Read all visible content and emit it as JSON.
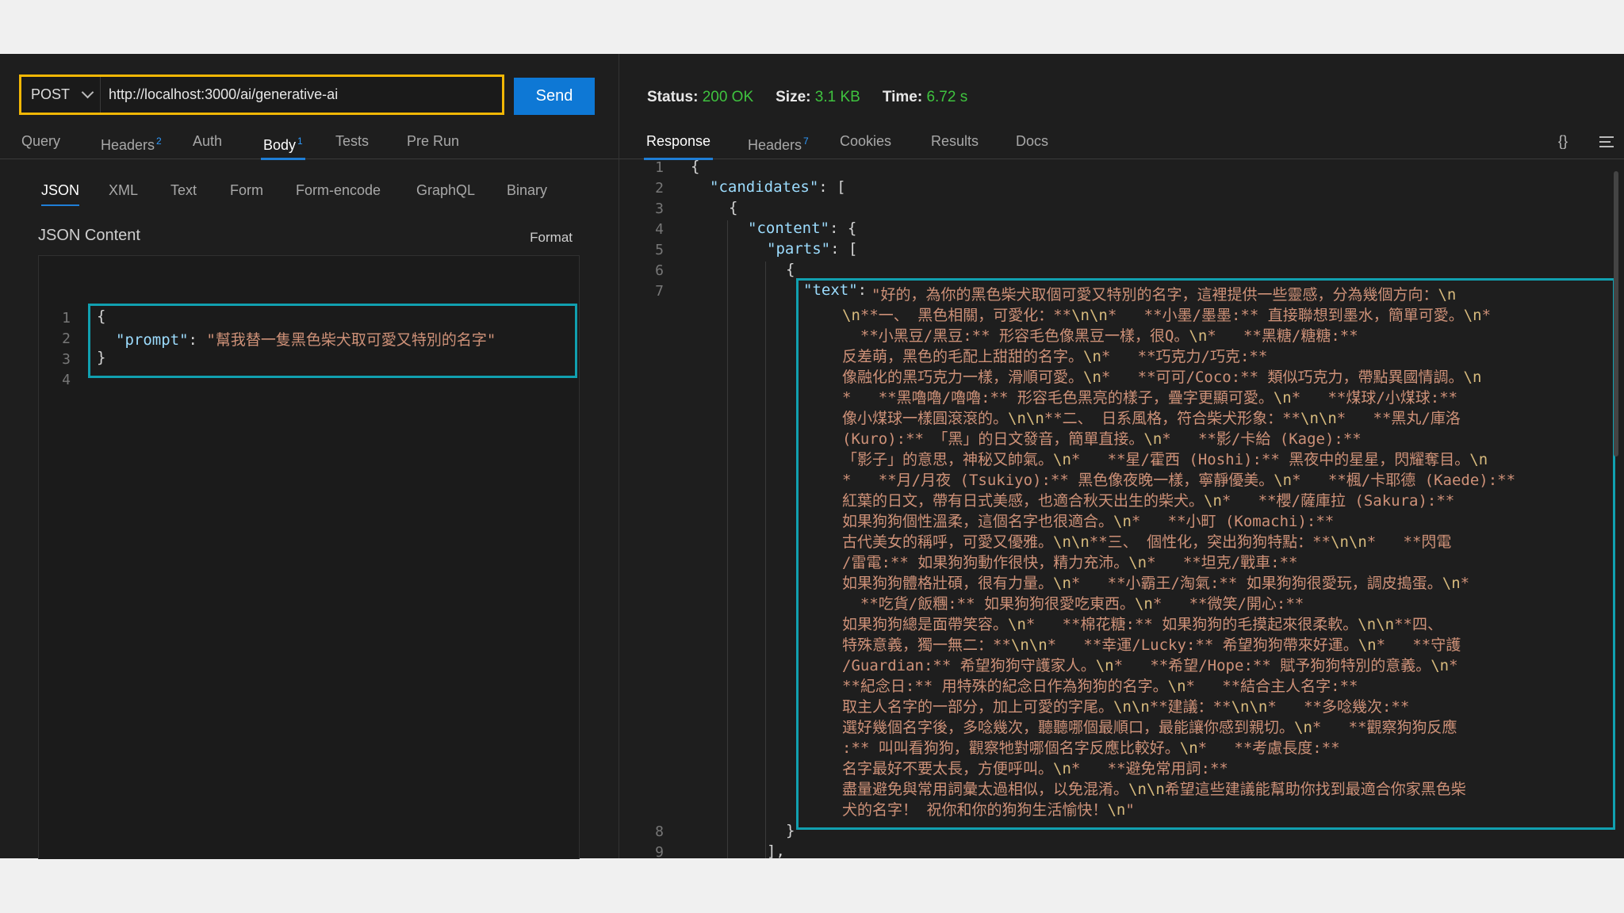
{
  "request": {
    "method": "POST",
    "url": "http://localhost:3000/ai/generative-ai",
    "send_label": "Send",
    "tabs": [
      {
        "label": "Query"
      },
      {
        "label": "Headers",
        "badge": "2"
      },
      {
        "label": "Auth"
      },
      {
        "label": "Body",
        "badge": "1",
        "active": true
      },
      {
        "label": "Tests"
      },
      {
        "label": "Pre Run"
      }
    ],
    "body_tabs": [
      "JSON",
      "XML",
      "Text",
      "Form",
      "Form-encode",
      "GraphQL",
      "Binary"
    ],
    "json_content_label": "JSON Content",
    "format_label": "Format",
    "editor": {
      "line_numbers": [
        "1",
        "2",
        "3",
        "4"
      ],
      "open_brace": "{",
      "key": "\"prompt\"",
      "colon": ": ",
      "value": "\"幫我替一隻黑色柴犬取可愛又特別的名字\"",
      "close_brace": "}"
    }
  },
  "response": {
    "status_label": "Status:",
    "status_value": "200 OK",
    "size_label": "Size:",
    "size_value": "3.1 KB",
    "time_label": "Time:",
    "time_value": "6.72 s",
    "tabs": [
      {
        "label": "Response",
        "active": true
      },
      {
        "label": "Headers",
        "badge": "7"
      },
      {
        "label": "Cookies"
      },
      {
        "label": "Results"
      },
      {
        "label": "Docs"
      }
    ],
    "icons": [
      "braces-icon",
      "menu-icon"
    ],
    "braces_glyph": "{}",
    "line_numbers": [
      "1",
      "2",
      "3",
      "4",
      "5",
      "6",
      "7",
      "8",
      "9"
    ],
    "code": {
      "l1": "{",
      "l2_key": "\"candidates\"",
      "l2_rest": ": [",
      "l3": "{",
      "l4_key": "\"content\"",
      "l4_rest": ": {",
      "l5_key": "\"parts\"",
      "l5_rest": ": [",
      "l6": "{",
      "l7_key": "\"text\"",
      "l7_colon": ": ",
      "l8": "}",
      "l9": "],"
    },
    "text_lines": [
      "\"好的，為你的黑色柴犬取個可愛又特別的名字，這裡提供一些靈感，分為幾個方向：\\n",
      "\\n**一、 黑色相關，可愛化：**\\n\\n*   **小墨/墨墨:** 直接聯想到墨水，簡單可愛。\\n*",
      "  **小黑豆/黑豆:** 形容毛色像黑豆一樣，很Q。\\n*   **黑糖/糖糖:**",
      "反差萌，黑色的毛配上甜甜的名字。\\n*   **巧克力/巧克:**",
      "像融化的黑巧克力一樣，滑順可愛。\\n*   **可可/Coco:** 類似巧克力，帶點異國情調。\\n",
      "*   **黑嚕嚕/嚕嚕:** 形容毛色黑亮的樣子，疊字更顯可愛。\\n*   **煤球/小煤球:**",
      "像小煤球一樣圓滾滾的。\\n\\n**二、 日系風格，符合柴犬形象：**\\n\\n*   **黑丸/庫洛",
      "(Kuro):** 「黑」的日文發音，簡單直接。\\n*   **影/卡給 (Kage):**",
      "「影子」的意思，神秘又帥氣。\\n*   **星/霍西 (Hoshi):** 黑夜中的星星，閃耀奪目。\\n",
      "*   **月/月夜 (Tsukiyo):** 黑色像夜晚一樣，寧靜優美。\\n*   **楓/卡耶德 (Kaede):**",
      "紅葉的日文，帶有日式美感，也適合秋天出生的柴犬。\\n*   **櫻/薩庫拉 (Sakura):**",
      "如果狗狗個性溫柔，這個名字也很適合。\\n*   **小町 (Komachi):**",
      "古代美女的稱呼，可愛又優雅。\\n\\n**三、 個性化，突出狗狗特點：**\\n\\n*   **閃電",
      "/雷電:** 如果狗狗動作很快，精力充沛。\\n*   **坦克/戰車:**",
      "如果狗狗體格壯碩，很有力量。\\n*   **小霸王/淘氣:** 如果狗狗很愛玩，調皮搗蛋。\\n*",
      "  **吃貨/飯糰:** 如果狗狗很愛吃東西。\\n*   **微笑/開心:**",
      "如果狗狗總是面帶笑容。\\n*   **棉花糖:** 如果狗狗的毛摸起來很柔軟。\\n\\n**四、",
      "特殊意義，獨一無二：**\\n\\n*   **幸運/Lucky:** 希望狗狗帶來好運。\\n*   **守護",
      "/Guardian:** 希望狗狗守護家人。\\n*   **希望/Hope:** 賦予狗狗特別的意義。\\n*",
      "**紀念日:** 用特殊的紀念日作為狗狗的名字。\\n*   **結合主人名字:**",
      "取主人名字的一部分，加上可愛的字尾。\\n\\n**建議：**\\n\\n*   **多唸幾次:**",
      "選好幾個名字後，多唸幾次，聽聽哪個最順口，最能讓你感到親切。\\n*   **觀察狗狗反應",
      ":** 叫叫看狗狗，觀察牠對哪個名字反應比較好。\\n*   **考慮長度:**",
      "名字最好不要太長，方便呼叫。\\n*   **避免常用詞:**",
      "盡量避免與常用詞彙太過相似，以免混淆。\\n\\n希望這些建議能幫助你找到最適合你家黑色柴",
      "犬的名字！ 祝你和你的狗狗生活愉快！\\n\""
    ]
  },
  "colors": {
    "url_highlight": "#f2b705",
    "annotation_box": "#11a0b0",
    "send_button": "#0e78d5",
    "status_ok": "#3fc33f"
  }
}
